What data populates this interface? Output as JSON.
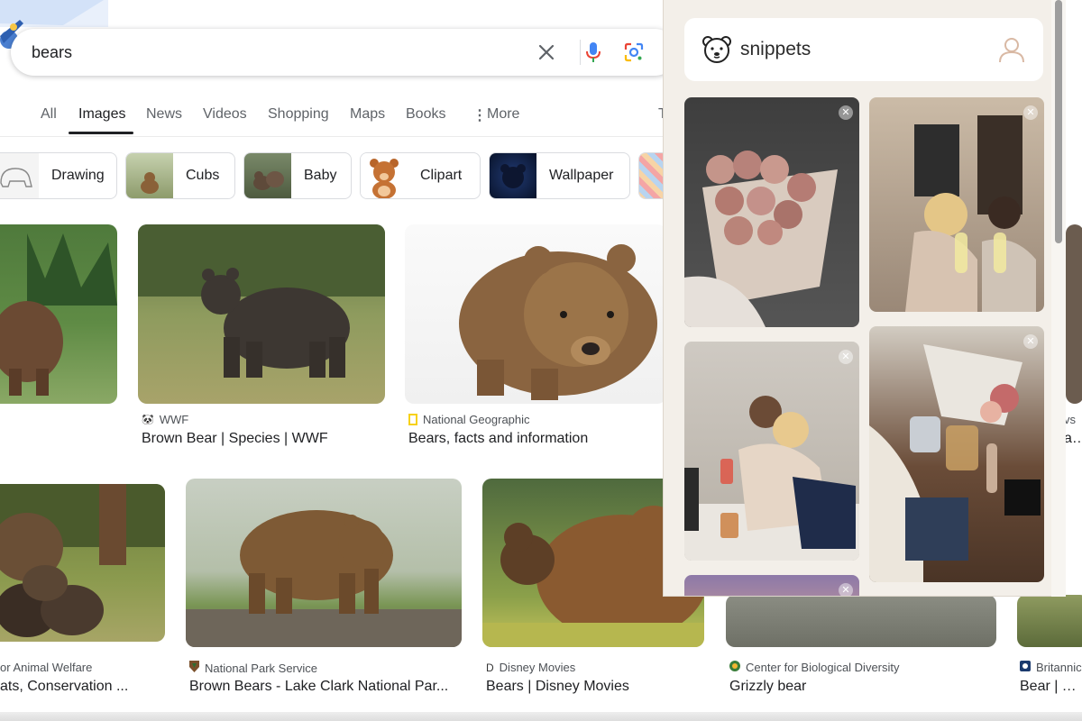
{
  "search": {
    "query": "bears"
  },
  "tabs": [
    {
      "label": "All"
    },
    {
      "label": "Images"
    },
    {
      "label": "News"
    },
    {
      "label": "Videos"
    },
    {
      "label": "Shopping"
    },
    {
      "label": "Maps"
    },
    {
      "label": "Books"
    },
    {
      "label": "More"
    }
  ],
  "chips": [
    {
      "label": "Drawing"
    },
    {
      "label": "Cubs"
    },
    {
      "label": "Baby"
    },
    {
      "label": "Clipart"
    },
    {
      "label": "Wallpaper"
    }
  ],
  "results": [
    {
      "source": "WWF",
      "title": "Brown Bear | Species | WWF"
    },
    {
      "source": "National Geographic",
      "title": "Bears, facts and information"
    },
    {
      "source": "or Animal Welfare",
      "title": "ats, Conservation ..."
    },
    {
      "source": "National Park Service",
      "title": "Brown Bears - Lake Clark National Par..."
    },
    {
      "source": "Disney Movies",
      "title": "Bears | Disney Movies"
    },
    {
      "source": "Center for Biological Diversity",
      "title": "Grizzly bear"
    },
    {
      "source": "Britannic",
      "title": "Bear | Typ"
    }
  ],
  "peek": {
    "source_fragment": "vs",
    "title_fragment": "ars"
  },
  "tab_fragment": "T",
  "snippets": {
    "title": "snippets"
  },
  "colors": {
    "accent_tab": "#202124",
    "panel_bg": "#f3efe9"
  }
}
